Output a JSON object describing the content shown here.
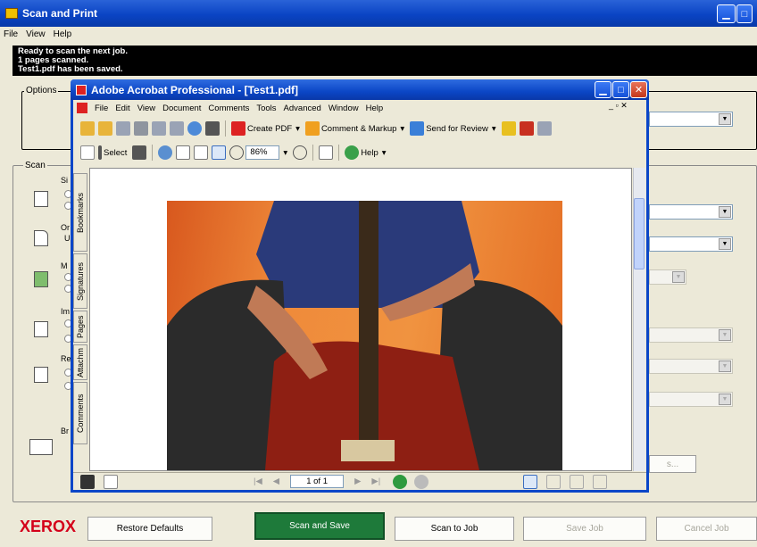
{
  "app": {
    "title": "Scan and Print"
  },
  "menu": [
    "File",
    "View",
    "Help"
  ],
  "status": {
    "lines": [
      "Ready to scan the next job.",
      "1 pages scanned.",
      "Test1.pdf has been saved."
    ]
  },
  "groups": {
    "options": "Options",
    "scan": "Scan"
  },
  "scan_partial_labels": [
    "Si",
    "Or",
    "U",
    "M",
    "Im",
    "Re",
    "Br"
  ],
  "xerox_logo": "XEROX",
  "buttons": {
    "restore": "Restore Defaults",
    "scan_save": "Scan and Save",
    "scan_job": "Scan to Job",
    "save_job": "Save Job",
    "cancel_job": "Cancel Job"
  },
  "acrobat": {
    "title": "Adobe Acrobat Professional - [Test1.pdf]",
    "menu": [
      "File",
      "Edit",
      "View",
      "Document",
      "Comments",
      "Tools",
      "Advanced",
      "Window",
      "Help"
    ],
    "toolbar1": {
      "create_pdf": "Create PDF",
      "comment_markup": "Comment & Markup",
      "send_review": "Send for Review"
    },
    "toolbar2": {
      "select": "Select",
      "zoom": "86%",
      "help": "Help"
    },
    "side_tabs": [
      "Bookmarks",
      "Signatures",
      "Pages",
      "Attachm",
      "Comments"
    ],
    "page_indicator": "1 of 1"
  },
  "colors": {
    "title_blue": "#0a46c8",
    "scan_save_green": "#1e7a3a",
    "xerox_red": "#d4001a"
  }
}
